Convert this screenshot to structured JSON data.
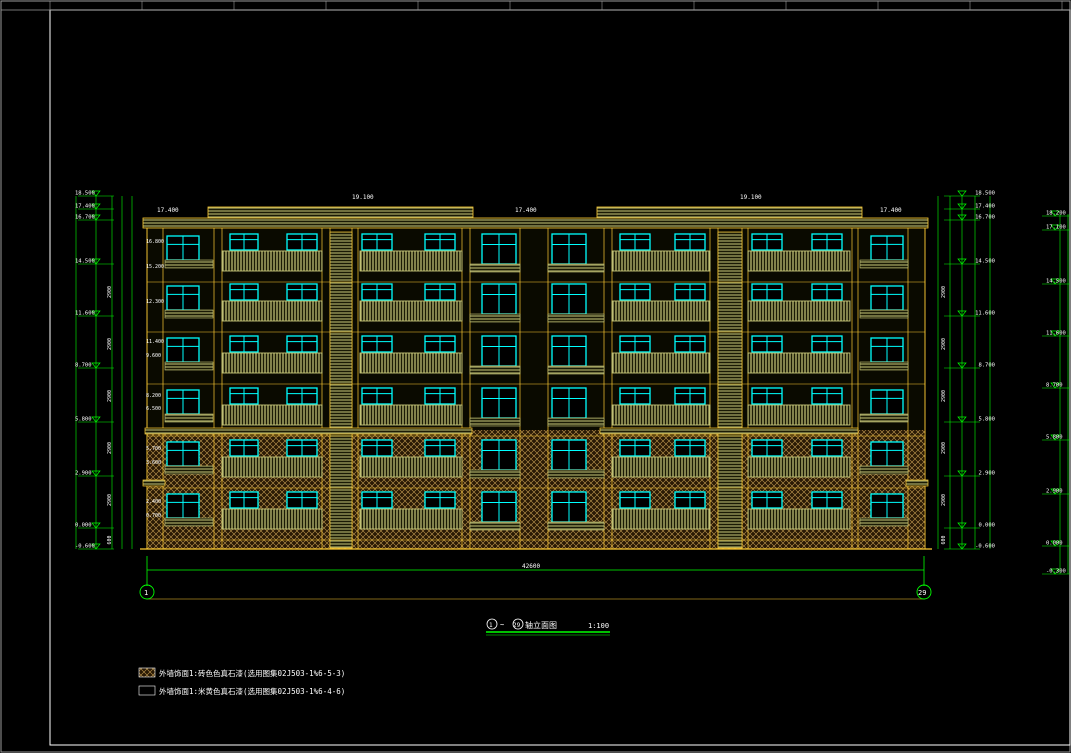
{
  "drawing": {
    "title_text": "轴立面图",
    "title_axis_start": "1",
    "title_axis_end": "29",
    "title_sep": "~",
    "scale": "1:100",
    "total_width": "42600",
    "axis_left": "1",
    "axis_right": "29"
  },
  "legend": [
    {
      "label": "外墙饰面1:砖色色真石漆(选用图集02J503-1%6-5-3)"
    },
    {
      "label": "外墙饰面1:米黄色真石漆(选用图集02J503-1%6-4-6)"
    }
  ],
  "top_labels": {
    "roof_left": "19.100",
    "roof_right": "19.100",
    "parapet_left": "17.400",
    "parapet_mid": "17.400",
    "parapet_right": "17.400"
  },
  "left_elevations": [
    "18.500",
    "17.400",
    "16.700",
    "14.500",
    "11.600",
    "8.700",
    "5.800",
    "2.900",
    "0.000",
    "-0.600"
  ],
  "right_elevations": [
    "18.500",
    "17.400",
    "16.700",
    "14.500",
    "11.600",
    "8.700",
    "5.800",
    "2.900",
    "0.000",
    "-0.600"
  ],
  "far_right_elevations": [
    "18.200",
    "17.100",
    "14.500",
    "11.600",
    "8.700",
    "5.800",
    "2.900",
    "0.000",
    "-0.300"
  ],
  "inner_left_labels": [
    "16.800",
    "15.200",
    "12.300",
    "11.400",
    "9.600",
    "8.200",
    "6.500",
    "5.700",
    "3.600",
    "2.400",
    "0.700"
  ],
  "left_dims": [
    "2900",
    "2900",
    "2900",
    "2900",
    "2900",
    "600"
  ],
  "colors": {
    "background": "#000000",
    "dim_line": "#00ff00",
    "wall_line": "#ffcc33",
    "window": "#00ffff",
    "panel": "#c8c87a",
    "text": "#ffffff",
    "brick": "#c09a50"
  }
}
